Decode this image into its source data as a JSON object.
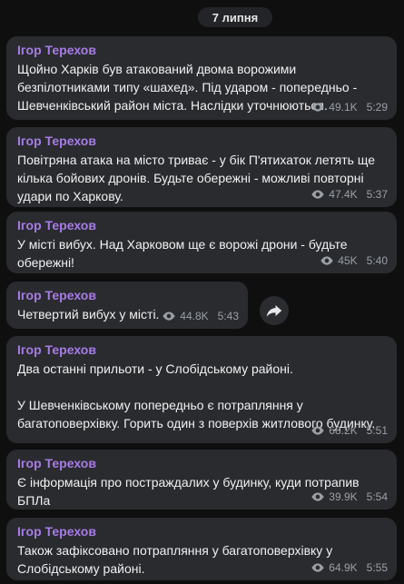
{
  "date_label": "7 липня",
  "messages": [
    {
      "author": "Ігор Терехов",
      "text": "Щойно Харків був атакований двома ворожими безпілотниками типу «шахед». Під ударом - попередньо - Шевченківський район міста. Наслідки уточнюються.",
      "views": "49.1K",
      "time": "5:29"
    },
    {
      "author": "Ігор Терехов",
      "text": "Повітряна атака на місто триває - у бік П'ятихаток летять ще кілька бойових дронів. Будьте обережні - можливі повторні удари по Харкову.",
      "views": "47.4K",
      "time": "5:37"
    },
    {
      "author": "Ігор Терехов",
      "text": "У місті вибух. Над Харковом ще є ворожі дрони - будьте обережні!",
      "views": "45K",
      "time": "5:40"
    },
    {
      "author": "Ігор Терехов",
      "text": "Четвертий вибух у місті.",
      "views": "44.8K",
      "time": "5:43"
    },
    {
      "author": "Ігор Терехов",
      "text": "Два останні прильоти - у Слобідському районі.\n\nУ Шевченківському попередньо є потрапляння у багатоповерхівку. Горить один з поверхів житлового будинку.",
      "views": "68.2K",
      "time": "5:51"
    },
    {
      "author": "Ігор Терехов",
      "text": "Є інформація про постраждалих у будинку, куди потрапив БПЛа",
      "views": "39.9K",
      "time": "5:54"
    },
    {
      "author": "Ігор Терехов",
      "text": "Також зафіксовано потрапляння у багатоповерхівку у Слобідському районі.",
      "views": "64.9K",
      "time": "5:55"
    }
  ],
  "icons": {
    "views": "eye-icon",
    "forward": "share-arrow-icon"
  },
  "colors": {
    "background": "#0f0f10",
    "bubble": "#2a2b2f",
    "author": "#a77ce6",
    "meta": "#9aa0a6"
  }
}
